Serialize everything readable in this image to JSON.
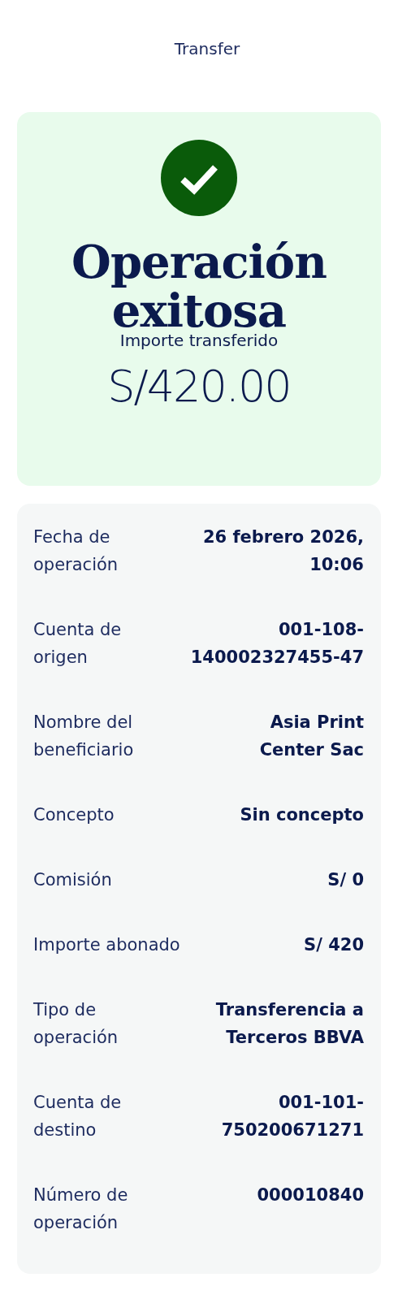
{
  "header": {
    "title": "Transfer"
  },
  "summary": {
    "succeeded": true,
    "title": "Operación exitosa",
    "amount_label": "Importe transferido",
    "amount": "S/420.00"
  },
  "details": [
    {
      "label": "Fecha de\noperación",
      "value": "26 febrero 2026,\n10:06"
    },
    {
      "label": "Cuenta de\norigen",
      "value": "001-108-\n140002327455-47"
    },
    {
      "label": "Nombre del\nbeneficiario",
      "value": "Asia Print\nCenter Sac"
    },
    {
      "label": "Concepto",
      "value": "Sin concepto"
    },
    {
      "label": "Comisión",
      "value": "S/ 0"
    },
    {
      "label": "Importe abonado",
      "value": "S/ 420"
    },
    {
      "label": "Tipo de\noperación",
      "value": "Transferencia a\nTerceros BBVA"
    },
    {
      "label": "Cuenta de\ndestino",
      "value": "001-101-\n750200671271"
    },
    {
      "label": "Número de\noperación",
      "value": "000010840"
    }
  ]
}
